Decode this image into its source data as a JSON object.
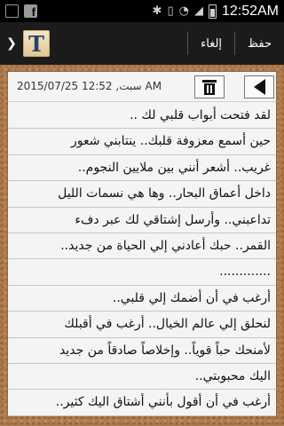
{
  "status_bar": {
    "time": "12:52AM",
    "left_icons": [
      "notification-icon",
      "facebook-icon"
    ],
    "right_icons": [
      "bluetooth-icon",
      "vibrate-icon",
      "wifi-icon",
      "signal-icon",
      "battery-icon"
    ]
  },
  "action_bar": {
    "logo_letter": "T",
    "save_label": "حفظ",
    "cancel_label": "إلغاء"
  },
  "note": {
    "date": "2015/07/25 سبت, 12:52 AM",
    "lines": [
      "لقد فتحت أبواب قلبي لك ..",
      "حين أسمع معزوفة قلبك.. ينتابني شعور",
      "غريب.. أشعر أنني بين ملايين النجوم..",
      "داخل أعماق البحار.. وها هي نسمات الليل",
      "تداعبني.. وأرسل إشتاقي لك عبر دفء",
      "القمر.. حبك أعادني إلي الحياة من جديد..",
      ".............",
      "أرغب في أن أضمك إلي قلبي..",
      "لنحلق إلي عالم الخيال.. أرغب في أقبلك",
      "لأمنحك حباً قوياً.. وإخلاصاً صادقاً من جديد",
      "اليك محبوبتي..",
      "أرغب في أن أقول بأنني أشتاق اليك كثير..",
      ""
    ]
  }
}
